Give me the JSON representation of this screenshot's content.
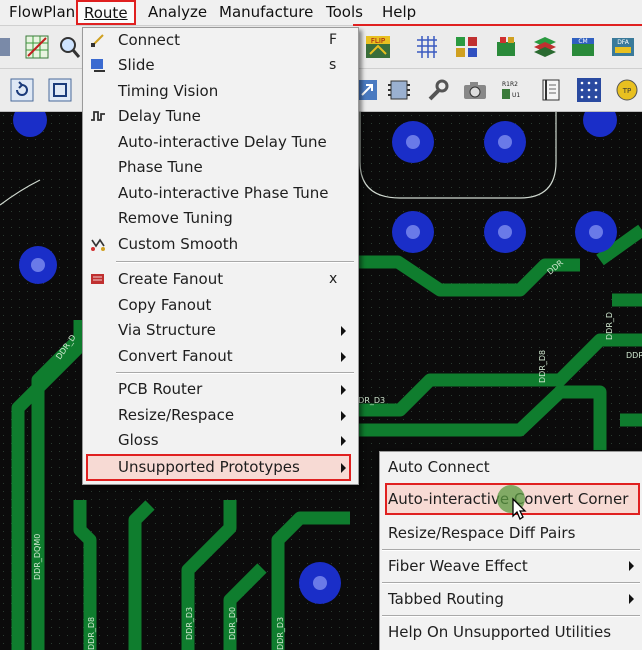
{
  "menubar": {
    "items": [
      {
        "label": "FlowPlan",
        "underline": ""
      },
      {
        "label": "Route",
        "underline": "R"
      },
      {
        "label": "Analyze",
        "underline": "A"
      },
      {
        "label": "Manufacture",
        "underline": "M"
      },
      {
        "label": "Tools",
        "underline": "T"
      },
      {
        "label": "Help",
        "underline": "H"
      }
    ]
  },
  "route_menu": {
    "items": [
      {
        "label": "Connect",
        "shortcut": "F",
        "icon": "connect-icon"
      },
      {
        "label": "Slide",
        "shortcut": "s",
        "icon": "slide-icon"
      },
      {
        "label": "Timing Vision",
        "shortcut": "",
        "icon": ""
      },
      {
        "label": "Delay Tune",
        "shortcut": "",
        "icon": "delay-tune-icon"
      },
      {
        "label": "Auto-interactive Delay Tune",
        "shortcut": "",
        "icon": ""
      },
      {
        "label": "Phase Tune",
        "shortcut": "",
        "icon": ""
      },
      {
        "label": "Auto-interactive Phase Tune",
        "shortcut": "",
        "icon": ""
      },
      {
        "label": "Remove Tuning",
        "shortcut": "",
        "icon": ""
      },
      {
        "label": "Custom Smooth",
        "shortcut": "",
        "icon": "custom-smooth-icon"
      },
      {
        "label": "Create Fanout",
        "shortcut": "x",
        "icon": "create-fanout-icon"
      },
      {
        "label": "Copy Fanout",
        "shortcut": "",
        "icon": ""
      },
      {
        "label": "Via Structure",
        "shortcut": "",
        "icon": "",
        "submenu": true
      },
      {
        "label": "Convert Fanout",
        "shortcut": "",
        "icon": "",
        "submenu": true
      },
      {
        "label": "PCB Router",
        "shortcut": "",
        "icon": "",
        "submenu": true
      },
      {
        "label": "Resize/Respace",
        "shortcut": "",
        "icon": "",
        "submenu": true
      },
      {
        "label": "Gloss",
        "shortcut": "",
        "icon": "",
        "submenu": true
      },
      {
        "label": "Unsupported Prototypes",
        "shortcut": "",
        "icon": "",
        "submenu": true,
        "highlighted": true
      }
    ]
  },
  "sub_menu": {
    "items": [
      {
        "label": "Auto Connect",
        "submenu": false
      },
      {
        "label": "Auto-interactive Convert Corner",
        "submenu": false,
        "highlighted": true
      },
      {
        "label": "Resize/Respace Diff Pairs",
        "submenu": false
      },
      {
        "label": "Fiber Weave Effect",
        "submenu": true
      },
      {
        "label": "Tabbed Routing",
        "submenu": true
      },
      {
        "label": "Help On Unsupported Utilities",
        "submenu": false
      }
    ]
  },
  "pcb": {
    "trace_labels": [
      "DDR_D3",
      "DDR_D8",
      "DDR_DQM0",
      "DDR_D3",
      "DDR_D0",
      "DDR_D8",
      "DDR_D3",
      "DDR_D",
      "DDR",
      "DDR_D",
      "DDR"
    ]
  },
  "colors": {
    "highlight_border": "#e02020",
    "trace": "#0f7d2e",
    "pad": "#1a2ec8",
    "board": "#0d0d0d"
  }
}
